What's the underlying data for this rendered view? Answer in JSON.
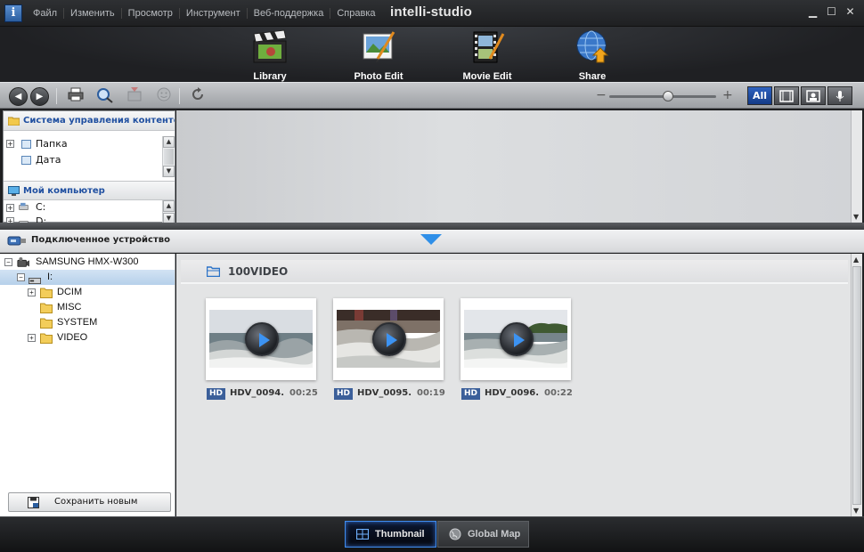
{
  "menu": {
    "items": [
      "Файл",
      "Изменить",
      "Просмотр",
      "Инструмент",
      "Веб-поддержка",
      "Справка"
    ]
  },
  "app": {
    "brand": "intelli-studio",
    "icon_letter": "i"
  },
  "window_controls": {
    "minimize": "▁",
    "maximize": "☐",
    "close": "✕"
  },
  "nav": {
    "items": [
      {
        "label": "Library",
        "icon": "clapperboard-icon"
      },
      {
        "label": "Photo Edit",
        "icon": "photo-edit-icon"
      },
      {
        "label": "Movie Edit",
        "icon": "film-edit-icon"
      },
      {
        "label": "Share",
        "icon": "globe-share-icon"
      }
    ],
    "active": "Library"
  },
  "toolbar": {
    "back": "◀",
    "forward": "▶",
    "zoom_minus": "−",
    "zoom_plus": "+",
    "zoom_level": 0.55,
    "filters": [
      {
        "label": "All",
        "icon": "all-text"
      },
      {
        "label": "",
        "icon": "film-icon"
      },
      {
        "label": "",
        "icon": "photo-icon"
      },
      {
        "label": "",
        "icon": "mic-icon"
      }
    ]
  },
  "content_mgmt": {
    "title": "Система управления контентом",
    "items": [
      "Папка",
      "Дата"
    ]
  },
  "my_computer": {
    "title": "Мой компьютер",
    "drives": [
      "C:",
      "D:"
    ]
  },
  "device": {
    "title": "Подключенное устройство",
    "name": "SAMSUNG HMX-W300",
    "drive": "I:",
    "folders": [
      "DCIM",
      "MISC",
      "SYSTEM",
      "VIDEO"
    ],
    "save_new": "Сохранить новым"
  },
  "folder": {
    "name": "100VIDEO"
  },
  "thumbnails": [
    {
      "badge": "HD",
      "name": "HDV_0094.",
      "duration": "00:25"
    },
    {
      "badge": "HD",
      "name": "HDV_0095.",
      "duration": "00:19"
    },
    {
      "badge": "HD",
      "name": "HDV_0096.",
      "duration": "00:22"
    }
  ],
  "bottom": {
    "thumbnail": "Thumbnail",
    "global_map": "Global Map"
  },
  "colors": {
    "accent_blue": "#2f8fe8",
    "badge_blue": "#3b5f9a",
    "active_filter": "#1f4fa0"
  }
}
